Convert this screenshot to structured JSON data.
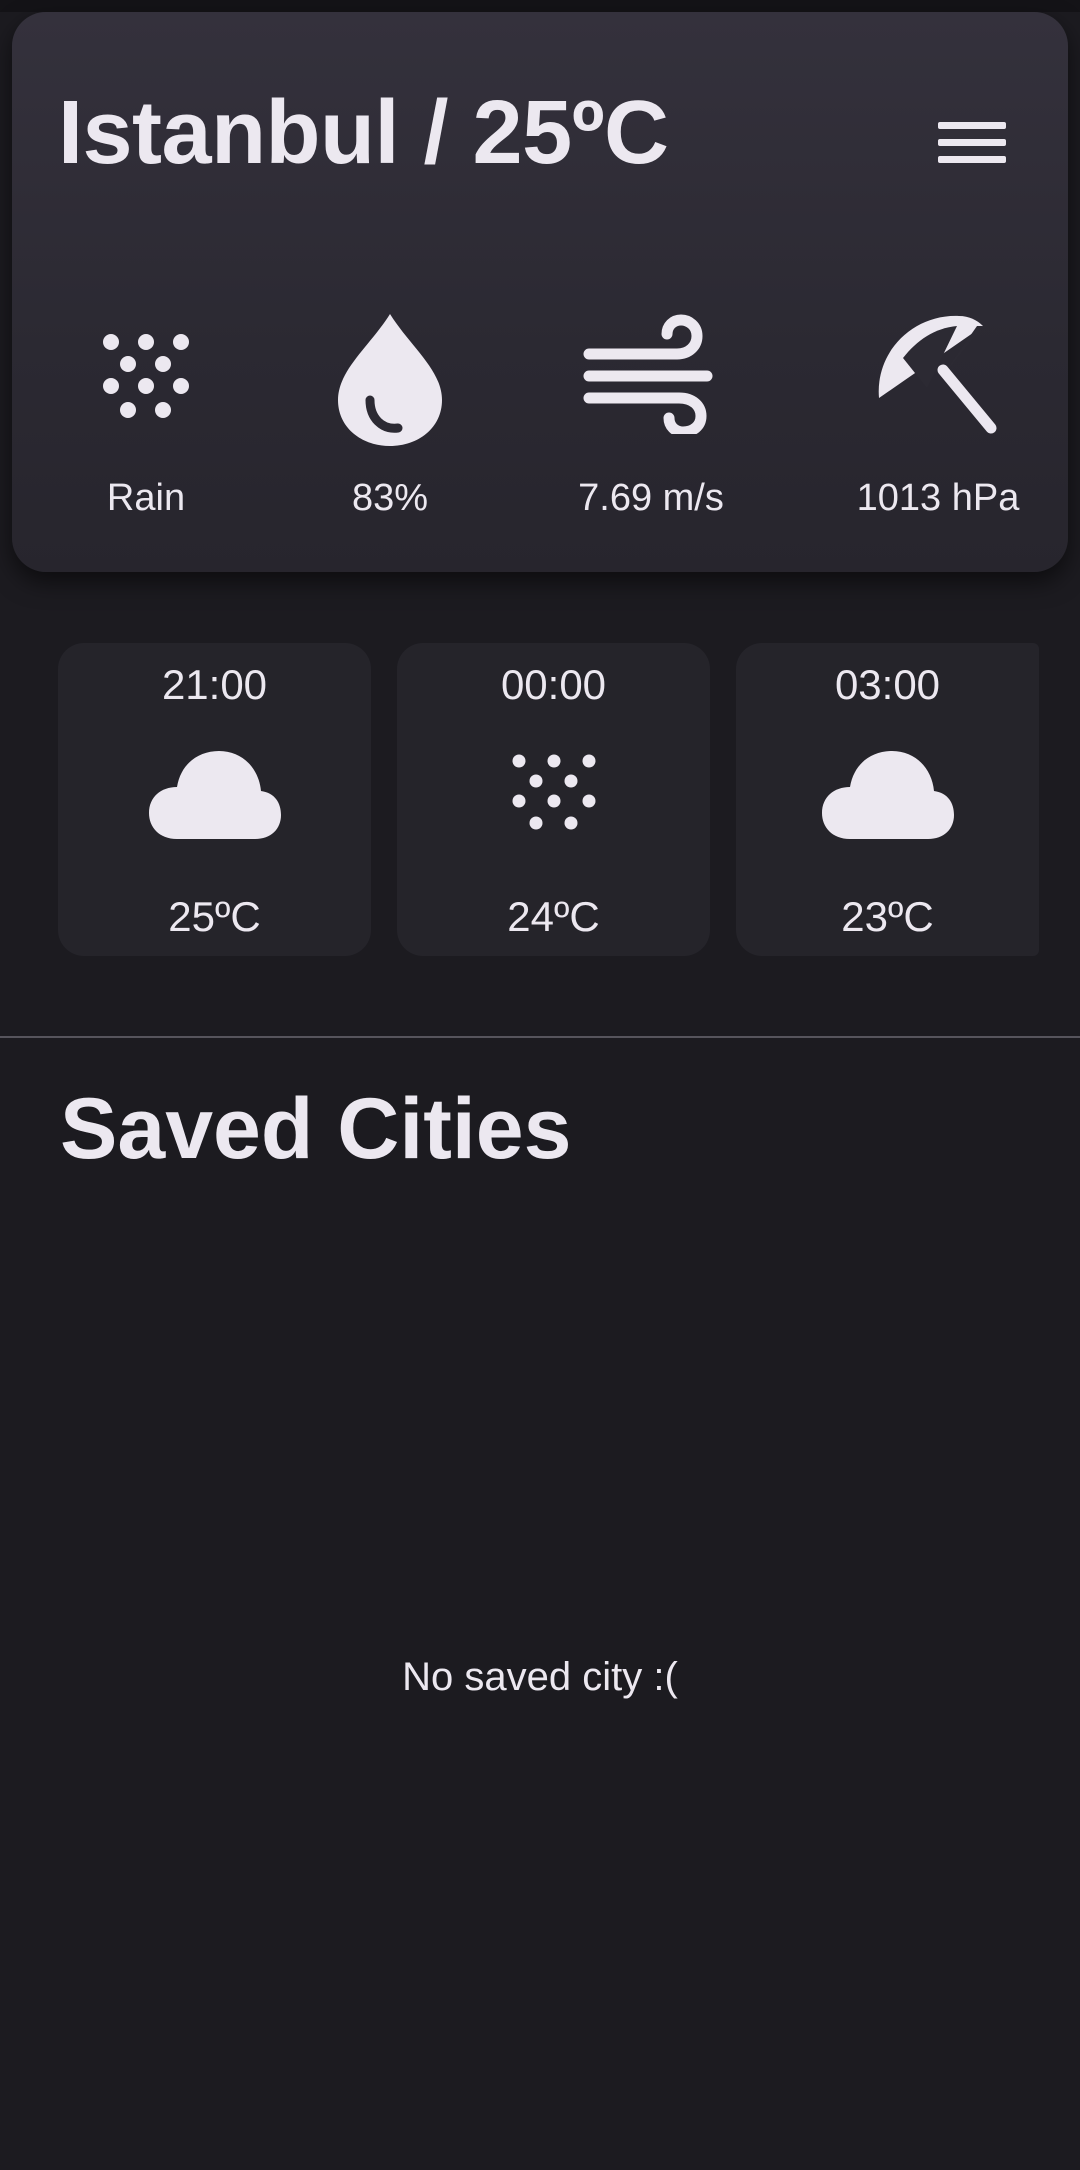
{
  "header": {
    "title": "Istanbul / 25ºC",
    "menu_icon": "hamburger-menu-icon"
  },
  "current": {
    "condition": {
      "icon": "rain-icon",
      "label": "Rain"
    },
    "humidity": {
      "icon": "water-drop-icon",
      "label": "83%"
    },
    "wind": {
      "icon": "wind-icon",
      "label": "7.69 m/s"
    },
    "pressure": {
      "icon": "beach-umbrella-icon",
      "label": "1013 hPa"
    }
  },
  "hourly": [
    {
      "time": "21:00",
      "icon": "cloud-icon",
      "temp": "25ºC"
    },
    {
      "time": "00:00",
      "icon": "rain-icon",
      "temp": "24ºC"
    },
    {
      "time": "03:00",
      "icon": "cloud-icon",
      "temp": "23ºC"
    }
  ],
  "saved": {
    "title": "Saved Cities",
    "empty_message": "No saved city :("
  },
  "colors": {
    "background": "#1c1b20",
    "card": "#25242a",
    "header_card": "#2f2c36",
    "text": "#ece8f0",
    "divider": "#56545c"
  }
}
